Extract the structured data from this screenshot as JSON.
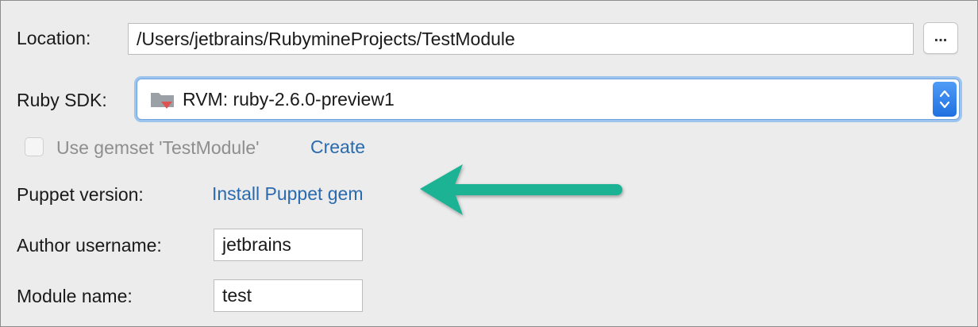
{
  "location": {
    "label": "Location:",
    "value": "/Users/jetbrains/RubymineProjects/TestModule",
    "browse_label": "..."
  },
  "ruby_sdk": {
    "label": "Ruby SDK:",
    "value": "RVM: ruby-2.6.0-preview1"
  },
  "gemset": {
    "label": "Use gemset 'TestModule'",
    "checked": false,
    "create_link": "Create"
  },
  "puppet": {
    "label": "Puppet version:",
    "install_link": "Install Puppet gem"
  },
  "author": {
    "label": "Author username:",
    "value": "jetbrains"
  },
  "module": {
    "label": "Module name:",
    "value": "test"
  },
  "colors": {
    "arrow": "#1ab394",
    "link": "#2a6aae",
    "focus_ring": "#9dc4ee"
  }
}
